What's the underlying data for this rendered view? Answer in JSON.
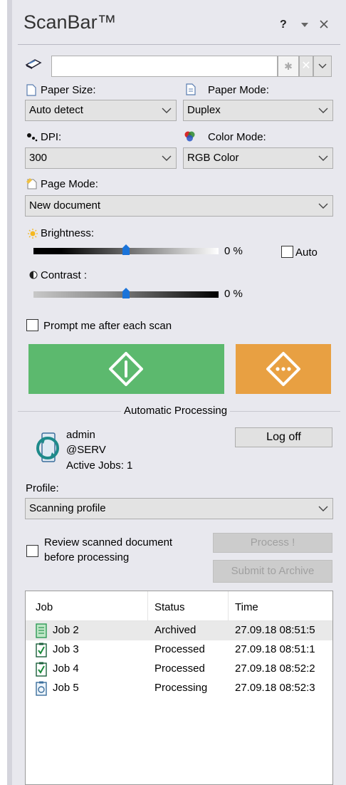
{
  "header": {
    "title": "ScanBar™",
    "help_label": "?"
  },
  "scanner": {
    "value": "",
    "placeholder": ""
  },
  "paper_size": {
    "label": "Paper Size:",
    "value": "Auto detect"
  },
  "paper_mode": {
    "label": "Paper Mode:",
    "value": "Duplex"
  },
  "dpi": {
    "label": "DPI:",
    "value": "300"
  },
  "color_mode": {
    "label": "Color Mode:",
    "value": "RGB Color"
  },
  "page_mode": {
    "label": "Page Mode:",
    "value": "New document"
  },
  "brightness": {
    "label": "Brightness:",
    "value_text": "0 %",
    "level": 0.5,
    "auto_label": "Auto",
    "auto_checked": false
  },
  "contrast": {
    "label": "Contrast :",
    "value_text": "0 %",
    "level": 0.5
  },
  "prompt": {
    "label": "Prompt me after each scan",
    "checked": false
  },
  "colors": {
    "scan_button": "#5cb96e",
    "alt_button": "#e8a042",
    "panel_bg": "#e8e8ee"
  },
  "processing": {
    "section_title": "Automatic Processing",
    "user": "admin",
    "server": "@SERV",
    "active_jobs": "Active Jobs: 1",
    "logoff_label": "Log off",
    "profile_label": "Profile:",
    "profile_value": "Scanning profile",
    "review_label_line1": "Review scanned document",
    "review_label_line2": "before processing",
    "review_checked": false,
    "process_label": "Process !",
    "submit_label": "Submit to Archive"
  },
  "jobs": {
    "columns": [
      "Job",
      "Status",
      "Time"
    ],
    "rows": [
      {
        "icon": "archived-job-icon",
        "job": "Job 2",
        "status": "Archived",
        "time": "27.09.18 08:51:5",
        "selected": true
      },
      {
        "icon": "processed-job-icon",
        "job": "Job 3",
        "status": "Processed",
        "time": "27.09.18 08:51:1",
        "selected": false
      },
      {
        "icon": "processed-job-icon",
        "job": "Job 4",
        "status": "Processed",
        "time": "27.09.18 08:52:2",
        "selected": false
      },
      {
        "icon": "processing-job-icon",
        "job": "Job 5",
        "status": "Processing",
        "time": "27.09.18 08:52:3",
        "selected": false
      }
    ]
  }
}
